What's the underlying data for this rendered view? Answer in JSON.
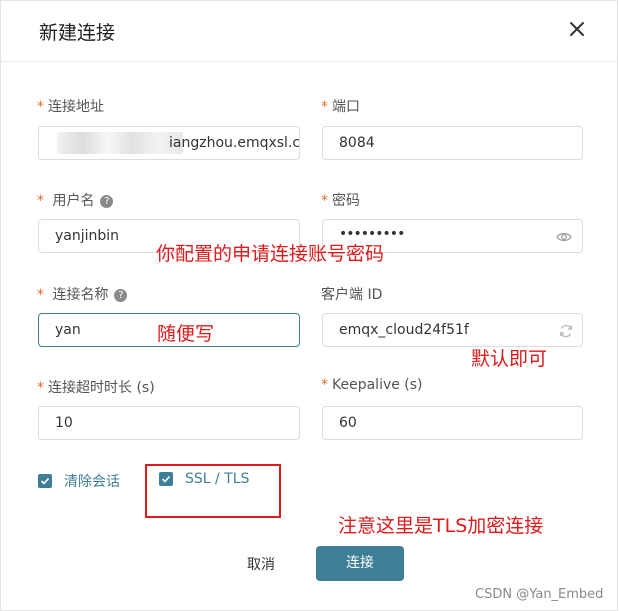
{
  "dialog": {
    "title": "新建连接"
  },
  "fields": {
    "host": {
      "required": "*",
      "label": "连接地址",
      "value": "iangzhou.emqxsl.c"
    },
    "port": {
      "required": "*",
      "label": "端口",
      "value": "8084"
    },
    "username": {
      "required": "*",
      "label": "用户名",
      "value": "yanjinbin"
    },
    "password": {
      "required": "*",
      "label": "密码",
      "value": "•••••••••"
    },
    "name": {
      "required": "*",
      "label": "连接名称",
      "value": "yan"
    },
    "client_id": {
      "label": "客户端 ID",
      "value": "emqx_cloud24f51f"
    },
    "timeout": {
      "required": "*",
      "label": "连接超时时长 (s)",
      "value": "10"
    },
    "keepalive": {
      "required": "*",
      "label": "Keepalive (s)",
      "value": "60"
    }
  },
  "help_glyph": "?",
  "checkboxes": {
    "clean_session": {
      "label": "清除会话",
      "checked": true
    },
    "ssl_tls": {
      "label": "SSL / TLS",
      "checked": true
    }
  },
  "buttons": {
    "cancel": "取消",
    "connect": "连接"
  },
  "annotations": {
    "account": "你配置的申请连接账号密码",
    "name": "随便写",
    "default": "默认即可",
    "tls": "注意这里是TLS加密连接"
  },
  "watermark": "CSDN @Yan_Embed",
  "colors": {
    "accent": "#3f7e97",
    "required": "#e06c2b",
    "annotation": "#e01a1a"
  },
  "icons": {
    "close": "close-icon",
    "help": "help-icon",
    "eye": "eye-icon",
    "refresh": "refresh-icon",
    "check": "check-icon"
  }
}
